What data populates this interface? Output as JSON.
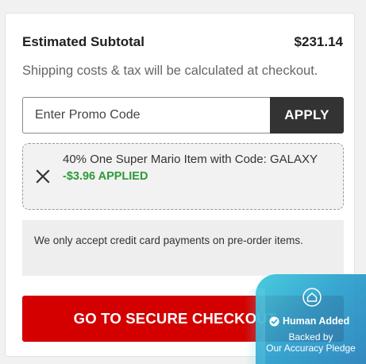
{
  "summary": {
    "subtotal_label": "Estimated Subtotal",
    "subtotal_value": "$231.14",
    "shipping_note": "Shipping costs & tax will be calculated at checkout."
  },
  "promo": {
    "placeholder": "Enter Promo Code",
    "apply_label": "APPLY",
    "applied": {
      "description": "40% One Super Mario Item with Code: GALAXY",
      "status": "-$3.96 APPLIED"
    }
  },
  "notice": "We only accept credit card payments on pre-order items.",
  "checkout": {
    "button_label": "GO TO SECURE CHECKOUT"
  },
  "badge": {
    "title": "Human Added",
    "line1": "Backed by",
    "line2": "Our Accuracy Pledge"
  },
  "colors": {
    "checkout_red": "#d40000",
    "apply_dark": "#333333",
    "applied_green": "#2e9b3a",
    "badge_teal": "#2aa6d2"
  },
  "icons": [
    "remove-x-icon",
    "house-shield-icon",
    "checkmark-icon"
  ]
}
